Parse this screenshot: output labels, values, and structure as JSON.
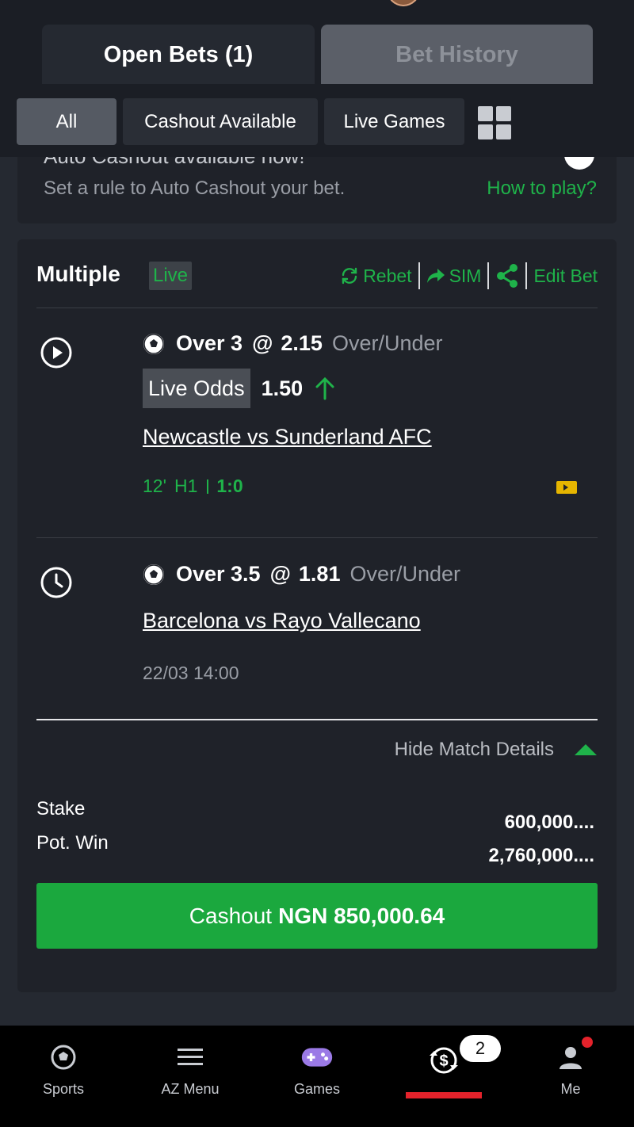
{
  "header": {
    "tabs": [
      {
        "label": "Open Bets (1)",
        "active": true
      },
      {
        "label": "Bet History",
        "active": false
      }
    ]
  },
  "filters": {
    "chips": [
      "All",
      "Cashout Available",
      "Live Games"
    ],
    "selected": "All",
    "layout_toggle_icon": "grid-icon"
  },
  "auto_cashout": {
    "title": "Auto Cashout available now!",
    "subtitle": "Set a rule to Auto Cashout your bet.",
    "link": "How to play?"
  },
  "bet": {
    "type": "Multiple",
    "live_badge": "Live",
    "actions": {
      "rebet": "Rebet",
      "sim": "SIM",
      "edit": "Edit Bet"
    },
    "legs": [
      {
        "status_icon": "play-icon",
        "selection": "Over 3",
        "at": "@",
        "odds": "2.15",
        "market": "Over/Under",
        "live_odds_label": "Live Odds",
        "live_odds_value": "1.50",
        "live_odds_trend": "up",
        "match": "Newcastle vs Sunderland AFC",
        "minute": "12'",
        "half": "H1",
        "score": "1:0"
      },
      {
        "status_icon": "clock-icon",
        "selection": "Over 3.5",
        "at": "@",
        "odds": "1.81",
        "market": "Over/Under",
        "match": "Barcelona vs Rayo Vallecano",
        "kickoff": "22/03 14:00"
      }
    ],
    "hide_details": "Hide Match Details",
    "stake_label": "Stake",
    "pot_win_label": "Pot. Win",
    "stake_value": "600,000....",
    "pot_win_value": "2,760,000....",
    "cashout_prefix": "Cashout",
    "cashout_amount": "NGN 850,000.64"
  },
  "colors": {
    "accent_green": "#1fb34a",
    "cashout_green": "#1ba83e",
    "alert_red": "#e4222b"
  },
  "bottom_nav": {
    "items": [
      "Sports",
      "AZ Menu",
      "Games",
      "",
      "Me"
    ],
    "active_index": 3,
    "bets_badge": "2"
  }
}
